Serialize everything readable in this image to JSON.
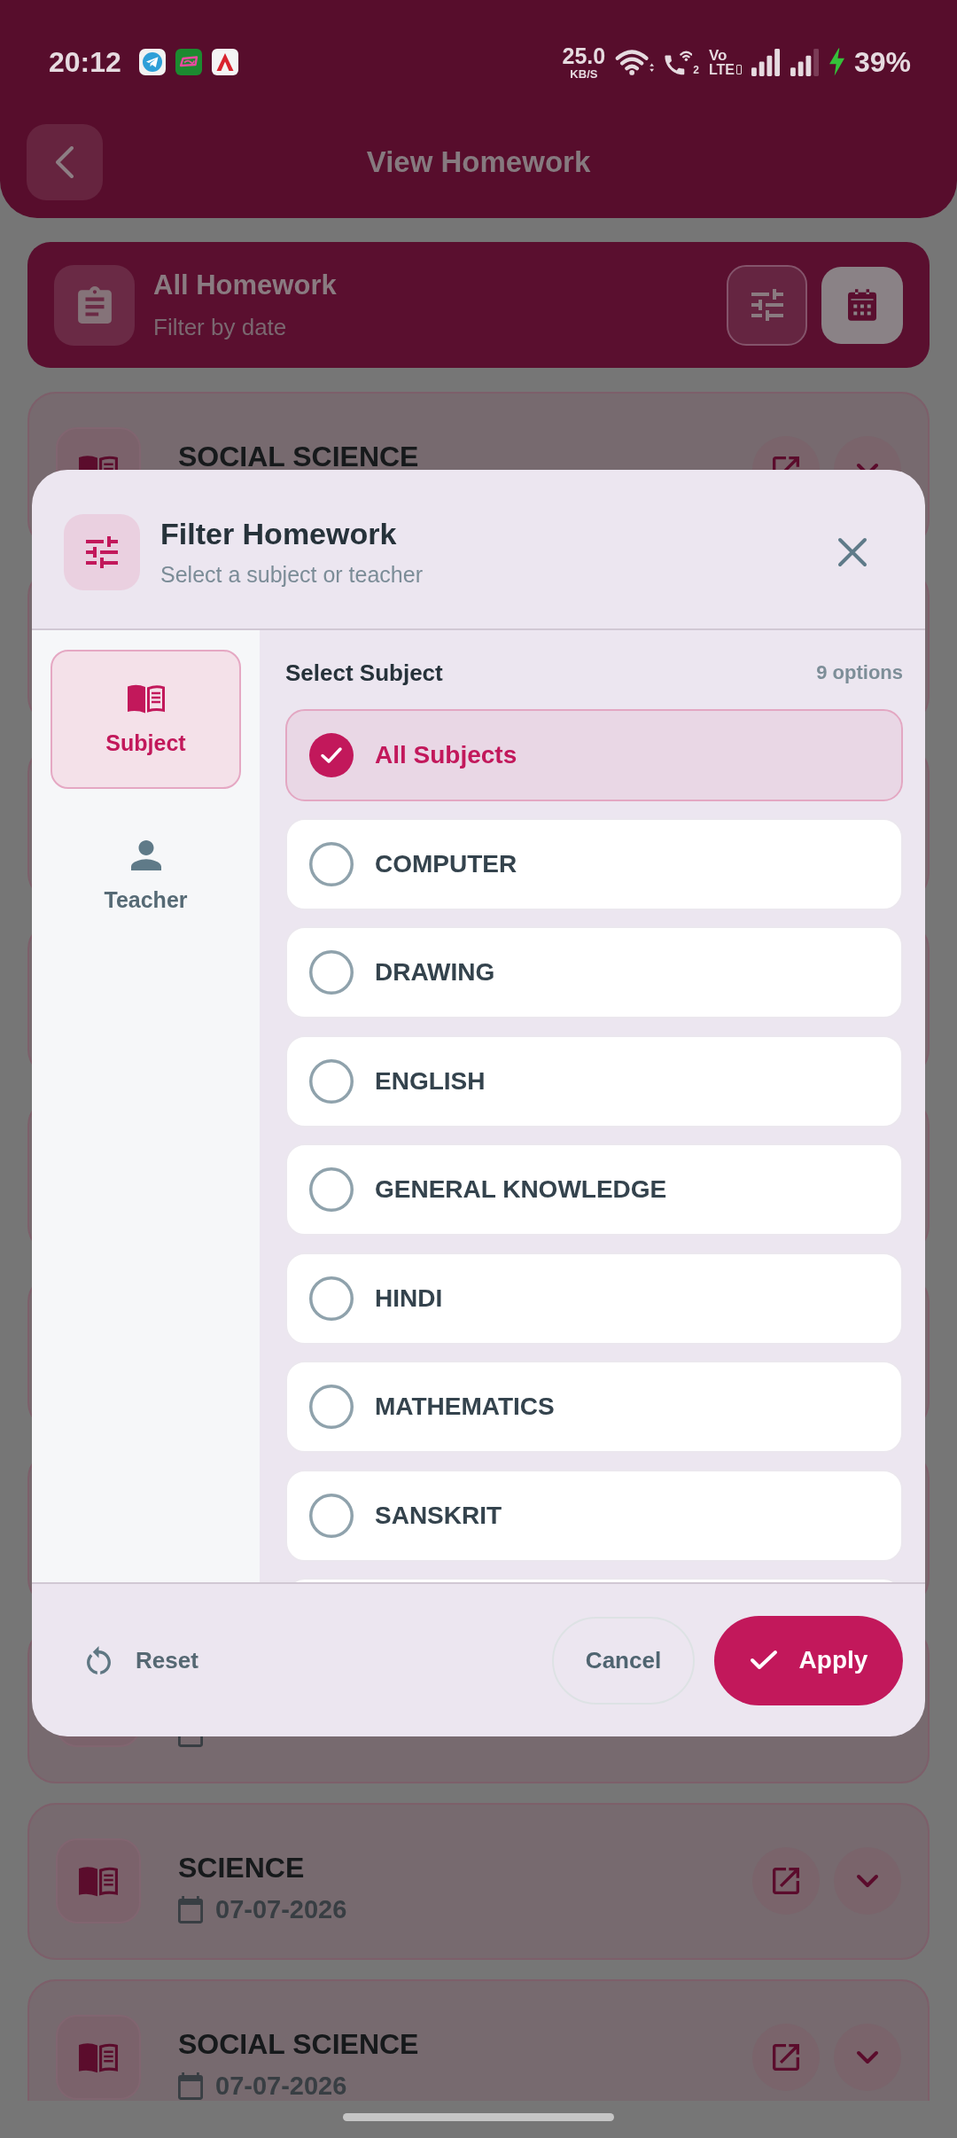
{
  "status_bar": {
    "time": "20:12",
    "speed": "25.0",
    "speed_unit": "KB/S",
    "call_sim": "2",
    "network_top": "Vo",
    "network_bottom": "LTE",
    "charging": true,
    "battery": "39%"
  },
  "header": {
    "title": "View Homework"
  },
  "summary_card": {
    "title": "All Homework",
    "subtitle": "Filter by date"
  },
  "homework_list": [
    {
      "kind": "title_only",
      "subject": "SOCIAL SCIENCE"
    },
    {
      "kind": "blank"
    },
    {
      "kind": "blank"
    },
    {
      "kind": "blank"
    },
    {
      "kind": "blank"
    },
    {
      "kind": "blank"
    },
    {
      "kind": "blank"
    },
    {
      "kind": "date_only"
    },
    {
      "kind": "full",
      "subject": "SCIENCE",
      "date": "07-07-2026"
    },
    {
      "kind": "full",
      "subject": "SOCIAL SCIENCE",
      "date": "07-07-2026"
    }
  ],
  "filter_dialog": {
    "title": "Filter Homework",
    "subtitle": "Select a subject or teacher",
    "tabs": [
      {
        "label": "Subject",
        "selected": true
      },
      {
        "label": "Teacher",
        "selected": false
      }
    ],
    "section_title": "Select Subject",
    "option_count": "9 options",
    "options": [
      {
        "label": "All Subjects",
        "selected": true
      },
      {
        "label": "COMPUTER",
        "selected": false
      },
      {
        "label": "DRAWING",
        "selected": false
      },
      {
        "label": "ENGLISH",
        "selected": false
      },
      {
        "label": "GENERAL KNOWLEDGE",
        "selected": false
      },
      {
        "label": "HINDI",
        "selected": false
      },
      {
        "label": "MATHEMATICS",
        "selected": false
      },
      {
        "label": "SANSKRIT",
        "selected": false
      }
    ],
    "actions": [
      {
        "kind": "reset",
        "label": "Reset"
      },
      {
        "kind": "cancel",
        "label": "Cancel"
      },
      {
        "kind": "apply",
        "label": "Apply"
      }
    ]
  }
}
